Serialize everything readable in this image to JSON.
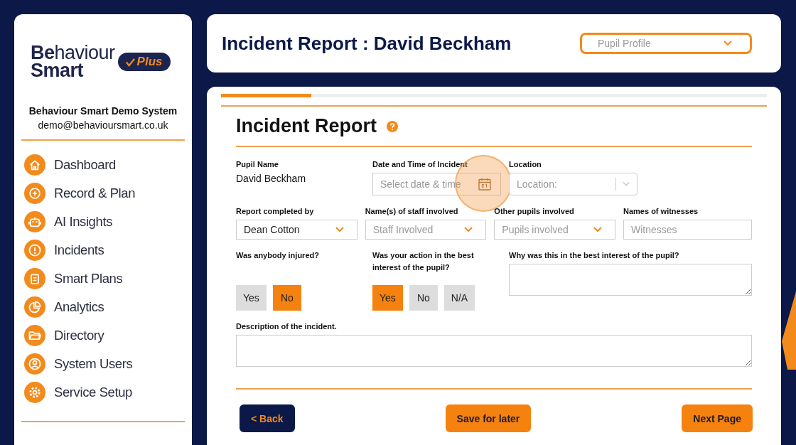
{
  "sidebar": {
    "logo": {
      "word_1_bold": "Be",
      "word_1_rest": "haviour",
      "word_2": "Smart",
      "badge": "Plus"
    },
    "organisation": "Behaviour Smart Demo System",
    "email": "demo@behavioursmart.co.uk",
    "items": [
      {
        "label": "Dashboard",
        "kind": "home"
      },
      {
        "label": "Record & Plan",
        "kind": "plus"
      },
      {
        "label": "AI Insights",
        "kind": "robot"
      },
      {
        "label": "Incidents",
        "kind": "alert"
      },
      {
        "label": "Smart Plans",
        "kind": "clipboard"
      },
      {
        "label": "Analytics",
        "kind": "pie"
      },
      {
        "label": "Directory",
        "kind": "folder"
      },
      {
        "label": "System Users",
        "kind": "user"
      },
      {
        "label": "Service Setup",
        "kind": "gear"
      }
    ]
  },
  "header": {
    "title": "Incident Report : David Beckham",
    "dropdown": {
      "placeholder": "Pupil Profile"
    }
  },
  "form": {
    "progress": {
      "level": 0.165
    },
    "title": "Incident Report",
    "rows": [
      [
        {
          "kind": "value",
          "label": "Pupil Name",
          "value": "David Beckham"
        },
        {
          "kind": "date",
          "label": "Date and Time of Incident",
          "placeholder": "Select date & time",
          "highlighted": true
        },
        {
          "kind": "combo",
          "label": "Location",
          "placeholder": "Location:"
        }
      ],
      [
        {
          "kind": "select",
          "label": "Report completed by",
          "value": "Dean Cotton"
        },
        {
          "kind": "select",
          "label": "Name(s) of staff involved",
          "placeholder": "Staff Involved"
        },
        {
          "kind": "select",
          "label": "Other pupils involved",
          "placeholder": "Pupils involved"
        },
        {
          "kind": "text",
          "label": "Names of witnesses",
          "placeholder": "Witnesses"
        }
      ],
      [
        {
          "kind": "toggle",
          "label": "Was anybody injured?",
          "options": [
            {
              "label": "Yes",
              "selected": false
            },
            {
              "label": "No",
              "selected": true
            }
          ]
        },
        {
          "kind": "toggle",
          "label": "Was your action in the best interest of the pupil?",
          "options": [
            {
              "label": "Yes",
              "selected": true
            },
            {
              "label": "No",
              "selected": false
            },
            {
              "label": "N/A",
              "selected": false
            }
          ]
        },
        {
          "kind": "textarea",
          "label": "Why was this in the best interest of the pupil?"
        }
      ],
      [
        {
          "kind": "textarea",
          "label": "Description of the incident."
        }
      ]
    ],
    "buttons": [
      {
        "label": "< Back",
        "kind": "secondary"
      },
      {
        "label": "Save for later",
        "kind": "primary"
      },
      {
        "label": "Next Page",
        "kind": "primary"
      }
    ]
  }
}
